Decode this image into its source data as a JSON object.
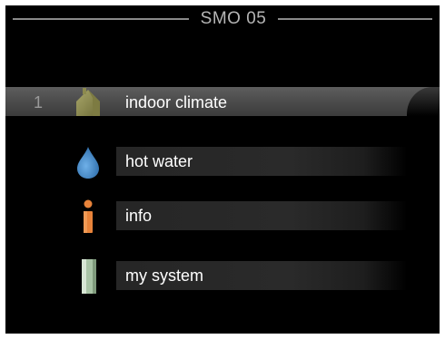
{
  "header": {
    "title": "SMO 05"
  },
  "menu": {
    "items": [
      {
        "number": "1",
        "label": "indoor climate",
        "icon": "house-icon",
        "selected": true
      },
      {
        "number": "",
        "label": "hot water",
        "icon": "water-drop-icon",
        "selected": false
      },
      {
        "number": "",
        "label": "info",
        "icon": "info-icon",
        "selected": false
      },
      {
        "number": "",
        "label": "my system",
        "icon": "system-unit-icon",
        "selected": false
      }
    ]
  },
  "colors": {
    "background": "#000000",
    "text": "#ffffff",
    "title": "#b5b5b5",
    "house": "#8c8a4e",
    "water": "#3d86c6",
    "info": "#e8833a",
    "system": "#a9c4a6"
  }
}
